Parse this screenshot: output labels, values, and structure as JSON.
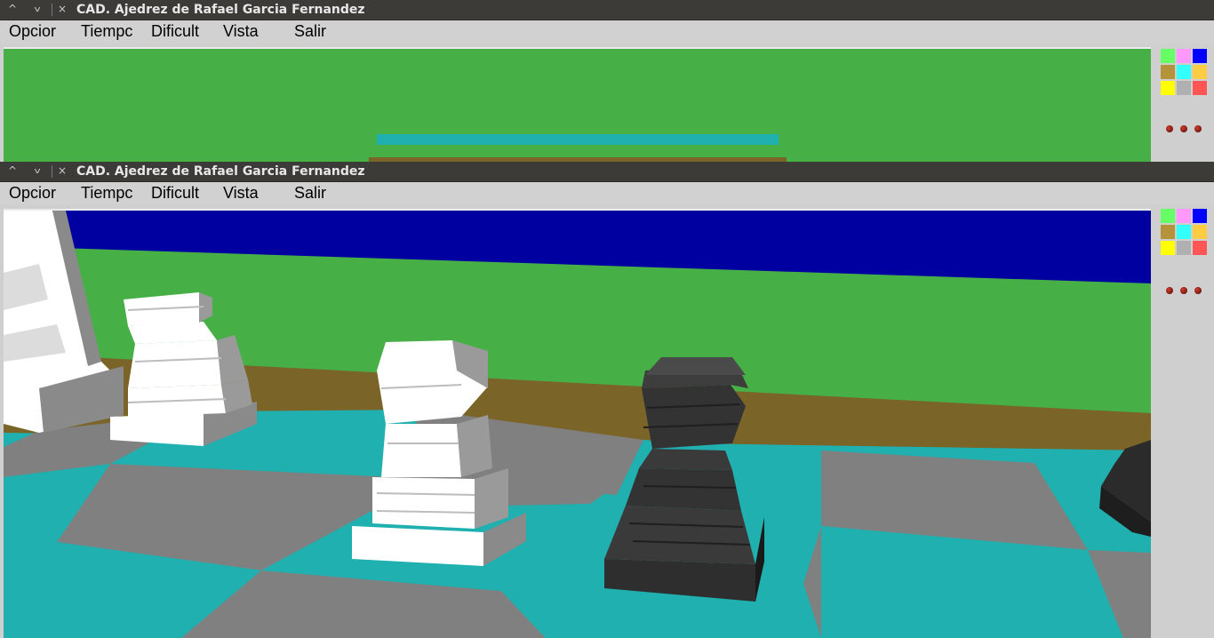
{
  "windows": [
    {
      "title": "CAD. Ajedrez de Rafael Garcia Fernandez",
      "controls": {
        "min": "^",
        "max": "v",
        "close": "×"
      },
      "menus": [
        "Opcior",
        "Tiempc",
        "Dificult",
        "Vista",
        "Salir"
      ]
    },
    {
      "title": "CAD. Ajedrez de Rafael Garcia Fernandez",
      "controls": {
        "min": "^",
        "max": "v",
        "close": "×"
      },
      "menus": [
        "Opcior",
        "Tiempc",
        "Dificult",
        "Vista",
        "Salir"
      ]
    }
  ],
  "palette_colors": [
    "#66ff66",
    "#ff99ff",
    "#0000ff",
    "#b5933a",
    "#33ffff",
    "#ffcc44",
    "#ffff00",
    "#b0b0b0",
    "#ff5555"
  ],
  "scene_colors": {
    "sky": "#0000a0",
    "wall": "#46b046",
    "table_edge": "#7a6428",
    "square_light": "#20b0b0",
    "square_dark": "#808080",
    "piece_white": "#ffffff",
    "piece_black": "#333333"
  },
  "icons": [
    "minimize-icon",
    "maximize-icon",
    "close-icon"
  ]
}
